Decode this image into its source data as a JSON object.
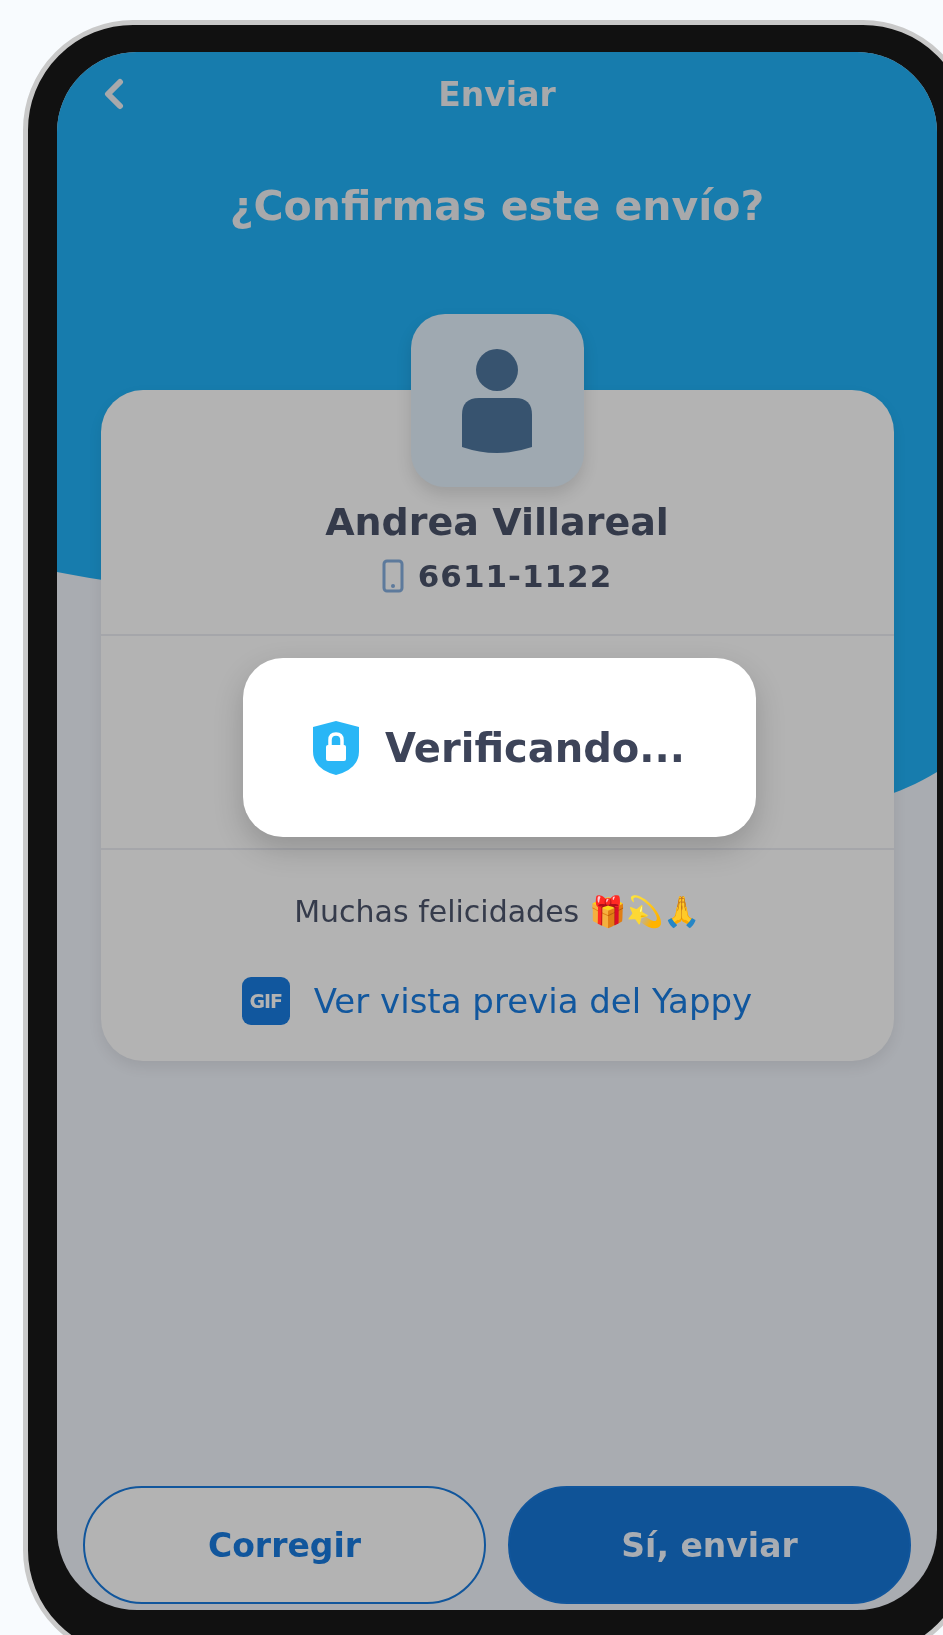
{
  "header": {
    "title": "Enviar"
  },
  "heading": "¿Confirmas este envío?",
  "recipient": {
    "name": "Andrea Villareal",
    "phone": "6611-1122"
  },
  "dialog": {
    "text": "Verificando..."
  },
  "message": "Muchas felicidades 🎁💫🙏",
  "preview_link": {
    "badge": "GIF",
    "label": "Ver vista previa del Yappy"
  },
  "buttons": [
    {
      "label": "Corregir",
      "kind": "outline"
    },
    {
      "label": "Sí, enviar",
      "kind": "filled"
    }
  ]
}
